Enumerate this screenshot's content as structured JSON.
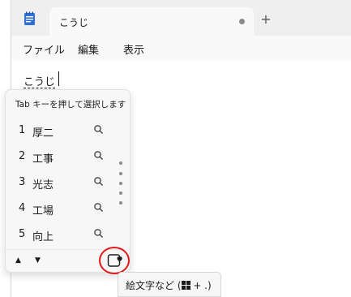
{
  "titlebar": {
    "tab_title": "こうじ",
    "new_tab_symbol": "+"
  },
  "menu": {
    "items": [
      "ファイル",
      "編集",
      "表示"
    ]
  },
  "editor": {
    "typed_text": "こうじ"
  },
  "ime": {
    "header": "Tab キーを押して選択します",
    "candidates": [
      {
        "num": "1",
        "text": "厚二"
      },
      {
        "num": "2",
        "text": "工事"
      },
      {
        "num": "3",
        "text": "光志"
      },
      {
        "num": "4",
        "text": "工場"
      },
      {
        "num": "5",
        "text": "向上"
      }
    ],
    "up_symbol": "▲",
    "down_symbol": "▼"
  },
  "tooltip": {
    "prefix": "絵文字など (",
    "suffix": " + .)"
  },
  "colors": {
    "highlight": "#e01818",
    "notepad_icon": "#2f6fd6"
  }
}
